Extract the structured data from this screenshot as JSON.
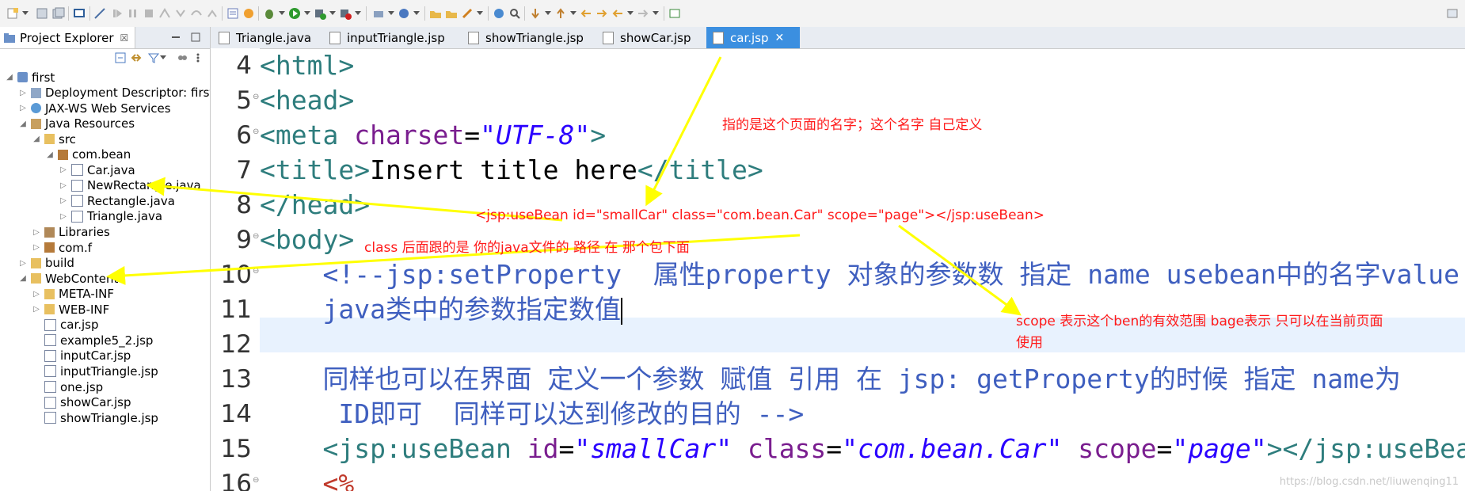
{
  "explorer": {
    "tab_title": "Project Explorer",
    "tab_close": "☒",
    "tree": [
      {
        "label": "first",
        "indent": 0,
        "twisty": "◢",
        "icon": "project-icon"
      },
      {
        "label": "Deployment Descriptor: first",
        "indent": 1,
        "twisty": "▷",
        "icon": "descriptor-icon"
      },
      {
        "label": "JAX-WS Web Services",
        "indent": 1,
        "twisty": "▷",
        "icon": "webservice-icon"
      },
      {
        "label": "Java Resources",
        "indent": 1,
        "twisty": "◢",
        "icon": "java-resources-icon"
      },
      {
        "label": "src",
        "indent": 2,
        "twisty": "◢",
        "icon": "folder-icon"
      },
      {
        "label": "com.bean",
        "indent": 3,
        "twisty": "◢",
        "icon": "package-icon"
      },
      {
        "label": "Car.java",
        "indent": 4,
        "twisty": "▷",
        "icon": "java-file-icon"
      },
      {
        "label": "NewRectangle.java",
        "indent": 4,
        "twisty": "▷",
        "icon": "java-file-icon"
      },
      {
        "label": "Rectangle.java",
        "indent": 4,
        "twisty": "▷",
        "icon": "java-file-icon"
      },
      {
        "label": "Triangle.java",
        "indent": 4,
        "twisty": "▷",
        "icon": "java-file-icon"
      },
      {
        "label": "Libraries",
        "indent": 2,
        "twisty": "▷",
        "icon": "library-icon"
      },
      {
        "label": "com.f",
        "indent": 2,
        "twisty": "▷",
        "icon": "package-icon"
      },
      {
        "label": "build",
        "indent": 1,
        "twisty": "▷",
        "icon": "folder-icon"
      },
      {
        "label": "WebContent",
        "indent": 1,
        "twisty": "◢",
        "icon": "folder-icon"
      },
      {
        "label": "META-INF",
        "indent": 2,
        "twisty": "▷",
        "icon": "folder-icon"
      },
      {
        "label": "WEB-INF",
        "indent": 2,
        "twisty": "▷",
        "icon": "folder-icon"
      },
      {
        "label": "car.jsp",
        "indent": 2,
        "twisty": "",
        "icon": "jsp-file-icon"
      },
      {
        "label": "example5_2.jsp",
        "indent": 2,
        "twisty": "",
        "icon": "jsp-file-icon"
      },
      {
        "label": "inputCar.jsp",
        "indent": 2,
        "twisty": "",
        "icon": "jsp-file-icon"
      },
      {
        "label": "inputTriangle.jsp",
        "indent": 2,
        "twisty": "",
        "icon": "jsp-file-icon"
      },
      {
        "label": "one.jsp",
        "indent": 2,
        "twisty": "",
        "icon": "jsp-file-icon"
      },
      {
        "label": "showCar.jsp",
        "indent": 2,
        "twisty": "",
        "icon": "jsp-file-icon"
      },
      {
        "label": "showTriangle.jsp",
        "indent": 2,
        "twisty": "",
        "icon": "jsp-file-icon"
      }
    ]
  },
  "editor": {
    "tabs": [
      {
        "label": "Triangle.java",
        "active": false
      },
      {
        "label": "inputTriangle.jsp",
        "active": false
      },
      {
        "label": "showTriangle.jsp",
        "active": false
      },
      {
        "label": "showCar.jsp",
        "active": false
      },
      {
        "label": "car.jsp",
        "active": true
      }
    ],
    "tab_close": "✕",
    "line_numbers": [
      "4",
      "5",
      "6",
      "7",
      "8",
      "9",
      "10",
      "11",
      "12",
      "13",
      "14",
      "15",
      "16"
    ],
    "lines": {
      "l4_tag": "<html>",
      "l5_tag": "<head>",
      "l6_open": "<meta ",
      "l6_attr": "charset",
      "l6_eq": "=",
      "l6_val": "\"UTF-8\"",
      "l6_close": ">",
      "l7_open": "<title>",
      "l7_text": "Insert title here",
      "l7_close": "</title>",
      "l8_tag": "</head>",
      "l9_tag": "<body>",
      "l10": "    <!--jsp:setProperty  属性property 对象的参数数 指定 name usebean中的名字value",
      "l11": "    java类中的参数指定数值",
      "l12": "",
      "l13": "    同样也可以在界面 定义一个参数 赋值 引用 在 jsp: getProperty的时候 指定 name为",
      "l14": "     ID即可  同样可以达到修改的目的 -->",
      "l15_open": "    <jsp:useBean ",
      "l15_a1": "id",
      "l15_v1": "\"smallCar\"",
      "l15_a2": "class",
      "l15_v2": "\"com.bean.Car\"",
      "l15_a3": "scope",
      "l15_v3": "\"page\"",
      "l15_close": "></jsp:useBean>",
      "l16": "    <%"
    }
  },
  "annotations": {
    "page_name": "指的是这个页面的名字；这个名字 自己定义",
    "usebean_code": "<jsp:useBean id=\"smallCar\" class=\"com.bean.Car\" scope=\"page\"></jsp:useBean>",
    "class_note": "class 后面跟的是 你的java文件的 路径 在 那个包下面",
    "scope_note_1": "scope 表示这个ben的有效范围  bage表示 只可以在当前页面",
    "scope_note_2": "使用"
  },
  "watermark": "https://blog.csdn.net/liuwenqing11",
  "colors": {
    "arrow": "#ffff00",
    "annotation_text": "#ff1a1a",
    "active_tab": "#3b8fe0",
    "current_line": "#e8f2fe"
  }
}
